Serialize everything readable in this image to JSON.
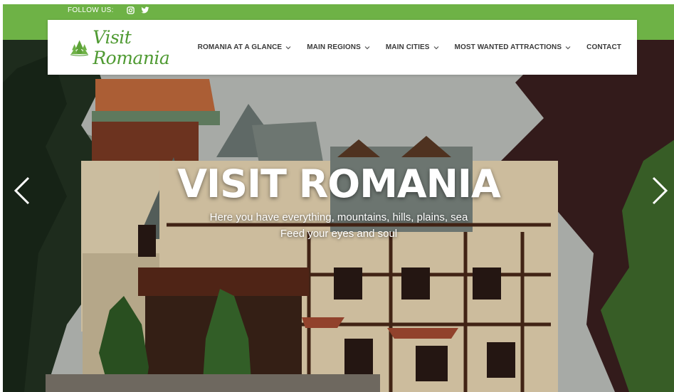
{
  "topbar": {
    "follow_label": "FOLLOW US:",
    "social": [
      {
        "icon": "instagram-icon"
      },
      {
        "icon": "twitter-icon"
      }
    ]
  },
  "brand": {
    "logo_text": "Visit Romania",
    "logo_icon": "pine-trees-icon"
  },
  "nav": {
    "items": [
      {
        "label": "ROMANIA AT A GLANCE",
        "dropdown": true
      },
      {
        "label": "MAIN REGIONS",
        "dropdown": true
      },
      {
        "label": "MAIN CITIES",
        "dropdown": true
      },
      {
        "label": "MOST WANTED ATTRACTIONS",
        "dropdown": true
      },
      {
        "label": "CONTACT",
        "dropdown": false
      }
    ]
  },
  "hero": {
    "title": "VISIT ROMANIA",
    "subtitle_line1": "Here you have everything, mountains, hills, plains, sea",
    "subtitle_line2": "Feed your eyes and soul",
    "prev_icon": "chevron-left-icon",
    "next_icon": "chevron-right-icon"
  },
  "colors": {
    "brand_green": "#6eb246",
    "logo_green": "#4f9a32",
    "nav_text": "#3a3a3a"
  }
}
